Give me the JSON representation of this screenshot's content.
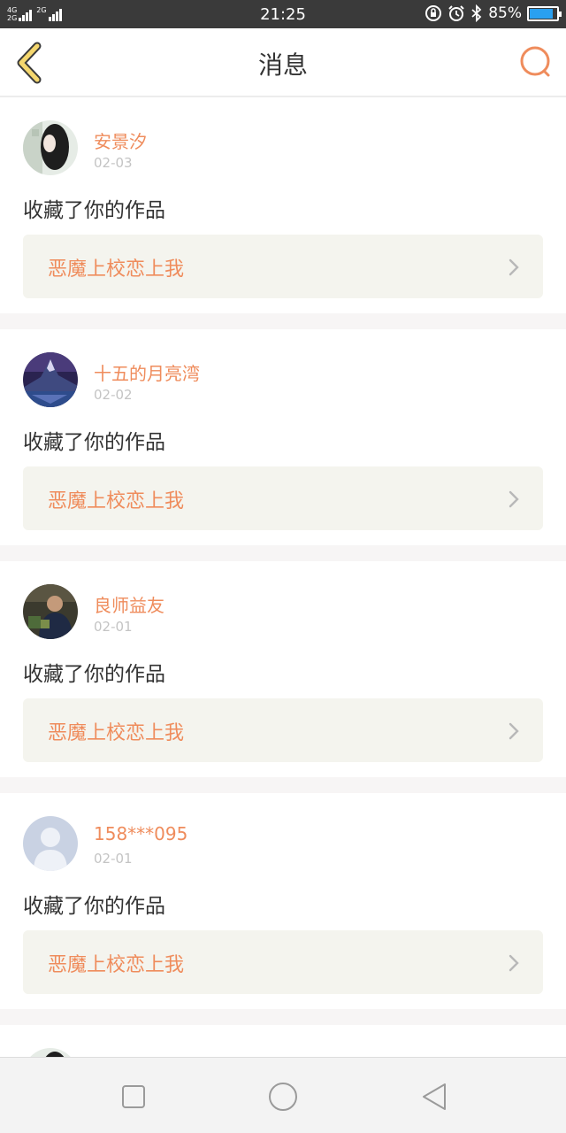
{
  "status_bar": {
    "network_top": "4G",
    "network_bottom": "2G",
    "network_right": "2G",
    "time": "21:25",
    "battery_percent": "85%",
    "battery_level": 0.85,
    "icons": [
      "signal-icon",
      "rotation-lock-icon",
      "alarm-icon",
      "bluetooth-icon",
      "battery-icon"
    ]
  },
  "header": {
    "title": "消息",
    "back_icon": "chevron-left-icon",
    "search_icon": "search-icon",
    "accent_color": "#ef8c5c"
  },
  "messages": [
    {
      "user": "安景汐",
      "date": "02-03",
      "action": "收藏了你的作品",
      "work": "恶魔上校恋上我",
      "avatar": "photo-dark-hair"
    },
    {
      "user": "十五的月亮湾",
      "date": "02-02",
      "action": "收藏了你的作品",
      "work": "恶魔上校恋上我",
      "avatar": "photo-mountain"
    },
    {
      "user": "良师益友",
      "date": "02-01",
      "action": "收藏了你的作品",
      "work": "恶魔上校恋上我",
      "avatar": "photo-person"
    },
    {
      "user": "158***095",
      "date": "02-01",
      "action": "收藏了你的作品",
      "work": "恶魔上校恋上我",
      "avatar": "default-user"
    }
  ],
  "nav_bar": {
    "buttons": [
      "recent-apps-icon",
      "home-icon",
      "back-triangle-icon"
    ]
  }
}
